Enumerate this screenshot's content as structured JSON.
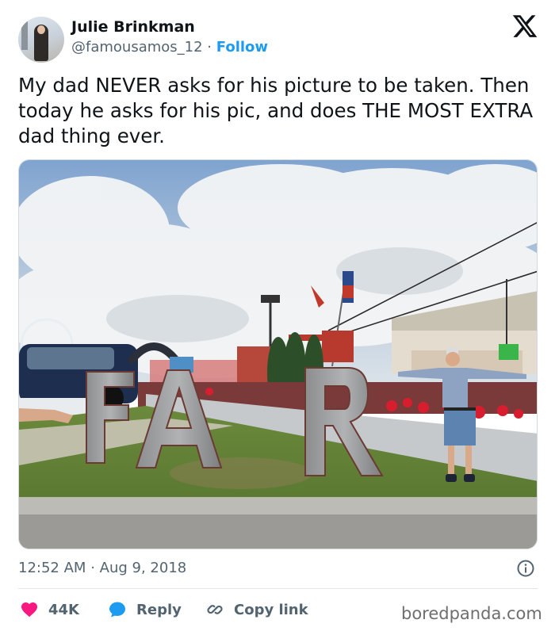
{
  "author": {
    "name": "Julie Brinkman",
    "handle": "@famousamos_12",
    "separator": "·",
    "follow_label": "Follow"
  },
  "tweet": {
    "text": "My dad NEVER asks for his picture to be taken. Then today he asks for his pic, and does THE MOST EXTRA dad thing ever."
  },
  "photo": {
    "sign_letters": [
      "F",
      "A",
      "R"
    ]
  },
  "meta": {
    "time": "12:52 AM",
    "separator": "·",
    "date": "Aug 9, 2018"
  },
  "actions": {
    "like_count": "44K",
    "reply_label": "Reply",
    "copy_label": "Copy link"
  },
  "watermark": "boredpanda.com",
  "colors": {
    "accent": "#1d9bf0",
    "like": "#f91880",
    "muted": "#536471"
  },
  "icons": [
    "x-logo-icon",
    "info-icon",
    "heart-icon",
    "reply-bubble-icon",
    "link-icon"
  ]
}
